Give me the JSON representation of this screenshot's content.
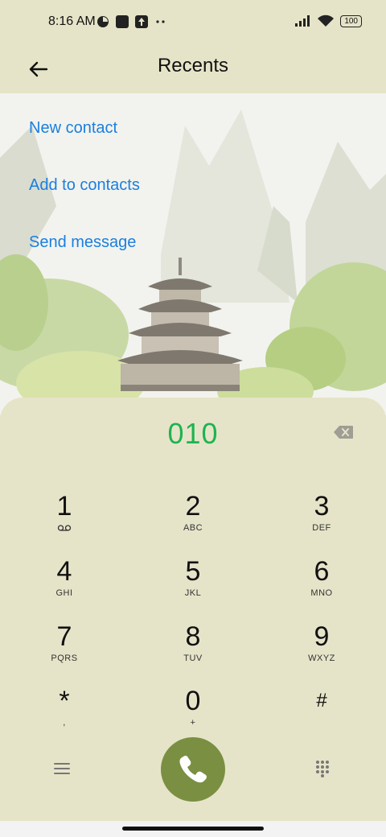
{
  "status": {
    "time": "8:16 AM",
    "battery": "100"
  },
  "header": {
    "title": "Recents"
  },
  "actions": {
    "new_contact": "New contact",
    "add_to_contacts": "Add to contacts",
    "send_message": "Send message"
  },
  "dialer": {
    "number": "010",
    "keys": [
      {
        "digit": "1",
        "letters": ""
      },
      {
        "digit": "2",
        "letters": "ABC"
      },
      {
        "digit": "3",
        "letters": "DEF"
      },
      {
        "digit": "4",
        "letters": "GHI"
      },
      {
        "digit": "5",
        "letters": "JKL"
      },
      {
        "digit": "6",
        "letters": "MNO"
      },
      {
        "digit": "7",
        "letters": "PQRS"
      },
      {
        "digit": "8",
        "letters": "TUV"
      },
      {
        "digit": "9",
        "letters": "WXYZ"
      },
      {
        "digit": "*",
        "letters": ","
      },
      {
        "digit": "0",
        "letters": "+"
      },
      {
        "digit": "#",
        "letters": ""
      }
    ]
  },
  "colors": {
    "accent_green": "#1db451",
    "link_blue": "#1a7fe0",
    "call_button": "#7a8f42",
    "panel": "#e6e4c8"
  },
  "icons": [
    "back-arrow-icon",
    "backspace-icon",
    "voicemail-icon",
    "menu-icon",
    "phone-icon",
    "dialpad-grid-icon"
  ]
}
